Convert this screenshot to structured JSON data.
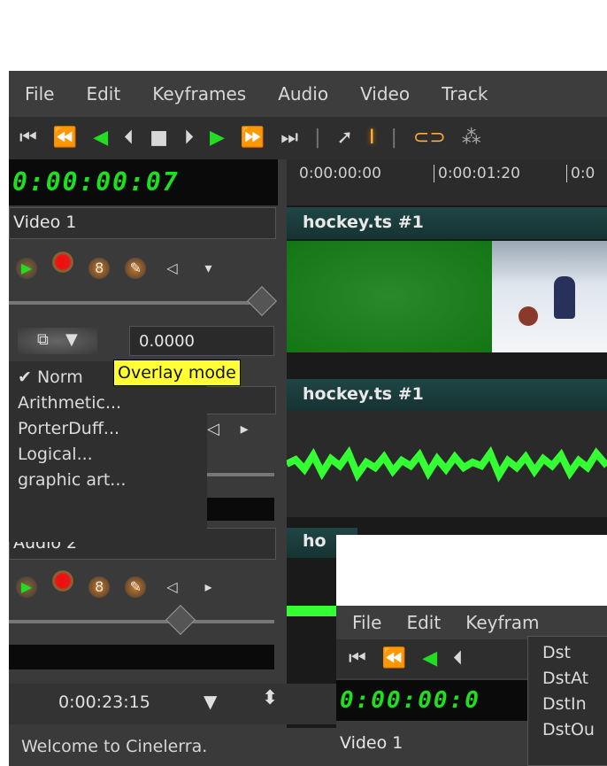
{
  "main_window": {
    "menus": [
      "File",
      "Edit",
      "Keyframes",
      "Audio",
      "Video",
      "Track"
    ],
    "transport_icons": [
      "rewind-to-start-icon",
      "fast-rewind-icon",
      "play-reverse-icon",
      "frame-back-icon",
      "stop-icon",
      "frame-forward-icon",
      "play-icon",
      "fast-forward-icon",
      "skip-to-end-icon"
    ],
    "tool_icons": [
      "arrow-tool-icon",
      "ibeam-tool-icon",
      "keyframe-icon",
      "more-icon"
    ],
    "timecode": "0:00:00:07",
    "ruler_labels": [
      "0:00:00:00",
      "0:00:01:20",
      "0:0"
    ],
    "track1": {
      "name": "Video 1",
      "fade_value": "0.0000",
      "clip_title": "hockey.ts #1"
    },
    "overlay_tooltip": "Overlay mode",
    "overlay_menu": {
      "items": [
        "Norm",
        "Arithmetic...",
        "PorterDuff...",
        "Logical...",
        "graphic art..."
      ],
      "checked_index": 0
    },
    "audio_clip_title": "hockey.ts #1",
    "track3": {
      "name": "Audio 2",
      "clip_title": "ho"
    },
    "position_time": "0:00:23:15",
    "status_text": "Welcome to Cinelerra."
  },
  "second_window": {
    "menus": [
      "File",
      "Edit",
      "Keyfram"
    ],
    "timecode": "0:00:00:0",
    "track_name": "Video 1",
    "submenu_items": [
      "Dst",
      "DstAt",
      "DstIn",
      "DstOu"
    ]
  },
  "colors": {
    "lcd_green": "#1ee01e",
    "play_green": "#22dd22",
    "record_red": "#ee1111",
    "tooltip_yellow": "#ffff33",
    "clip_header_teal": "#1f4645",
    "waveform_green": "#33ff33"
  }
}
